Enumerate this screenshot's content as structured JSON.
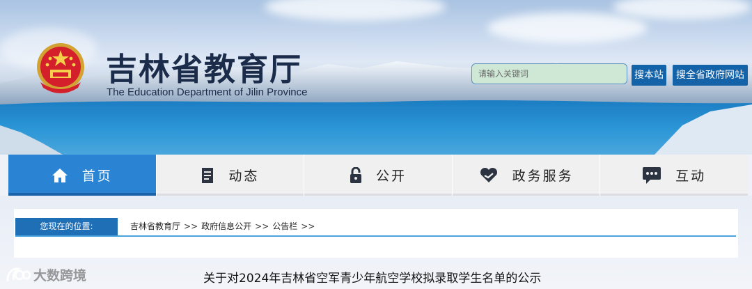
{
  "header": {
    "title_cn": "吉林省教育厅",
    "title_en": "The Education Department of Jilin Province",
    "emblem_icon": "national-emblem-icon"
  },
  "search": {
    "placeholder": "请输入关键词",
    "site_button": "搜本站",
    "gov_button": "搜全省政府网站"
  },
  "nav": {
    "items": [
      {
        "label": "首页",
        "icon": "home-icon",
        "active": true
      },
      {
        "label": "动态",
        "icon": "document-icon",
        "active": false
      },
      {
        "label": "公开",
        "icon": "lock-icon",
        "active": false
      },
      {
        "label": "政务服务",
        "icon": "heart-hands-icon",
        "active": false
      },
      {
        "label": "互动",
        "icon": "chat-icon",
        "active": false
      }
    ]
  },
  "breadcrumb": {
    "label": "您现在的位置:",
    "items": [
      "吉林省教育厅",
      "政府信息公开",
      "公告栏"
    ],
    "separator": ">>"
  },
  "article": {
    "title": "关于对2024年吉林省空军青少年航空学校拟录取学生名单的公示"
  },
  "watermark": {
    "text": "大数跨境"
  },
  "colors": {
    "nav_active": "#2b84d3",
    "button": "#1462a8",
    "breadcrumb_label": "#1f6fb7",
    "search_bg": "#cfe8d6"
  }
}
